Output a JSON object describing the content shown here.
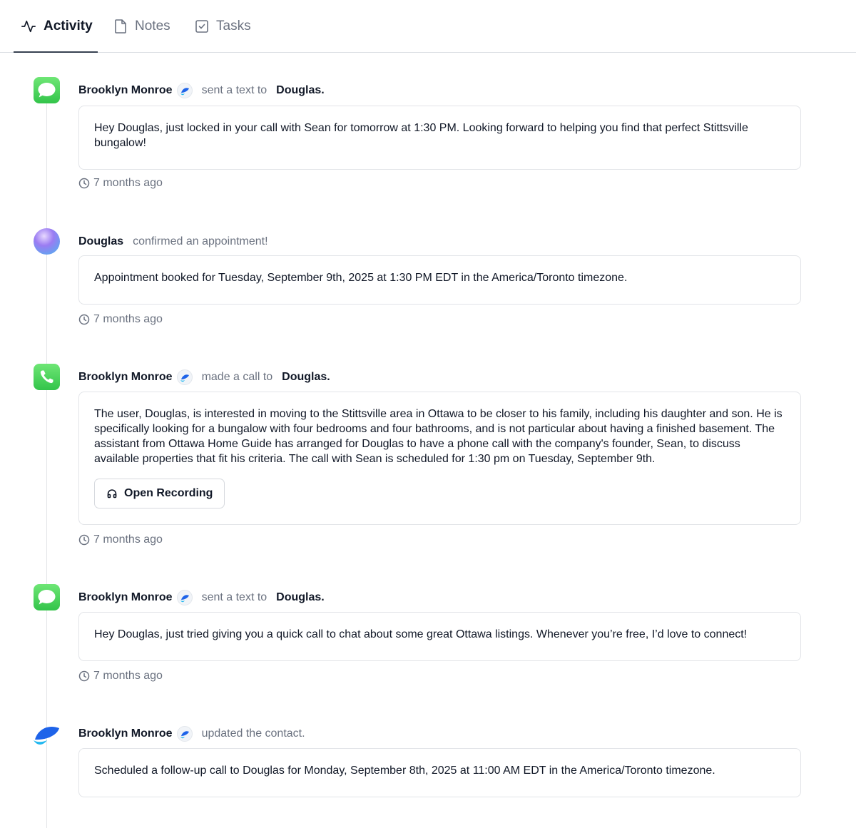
{
  "tabs": [
    {
      "label": "Activity",
      "icon": "activity-icon",
      "active": true
    },
    {
      "label": "Notes",
      "icon": "file-icon",
      "active": false
    },
    {
      "label": "Tasks",
      "icon": "checkbox-icon",
      "active": false
    }
  ],
  "colors": {
    "imessage_green": "#4cd964",
    "brand_blue": "#1e63e9",
    "text_primary": "#111827",
    "text_muted": "#6b7280",
    "border": "#e2e4e8"
  },
  "entries": [
    {
      "icon": "message-icon",
      "actor": "Brooklyn Monroe",
      "verb": "sent a text to",
      "target": "Douglas.",
      "body": "Hey Douglas, just locked in your call with Sean for tomorrow at 1:30 PM. Looking forward to helping you find that perfect Stittsville bungalow!",
      "time": "7 months ago"
    },
    {
      "icon": "contact-avatar-icon",
      "actor": "Douglas",
      "verb": "confirmed an appointment!",
      "body": "Appointment booked for Tuesday, September 9th, 2025 at 1:30 PM EDT in the America/Toronto timezone.",
      "time": "7 months ago"
    },
    {
      "icon": "phone-icon",
      "actor": "Brooklyn Monroe",
      "verb": "made a call to",
      "target": "Douglas.",
      "body": "The user, Douglas, is interested in moving to the Stittsville area in Ottawa to be closer to his family, including his daughter and son. He is specifically looking for a bungalow with four bedrooms and four bathrooms, and is not particular about having a finished basement. The assistant from Ottawa Home Guide has arranged for Douglas to have a phone call with the company's founder, Sean, to discuss available properties that fit his criteria. The call with Sean is scheduled for 1:30 pm on Tuesday, September 9th.",
      "button": "Open Recording",
      "time": "7 months ago"
    },
    {
      "icon": "message-icon",
      "actor": "Brooklyn Monroe",
      "verb": "sent a text to",
      "target": "Douglas.",
      "body": "Hey Douglas, just tried giving you a quick call to chat about some great Ottawa listings. Whenever you’re free, I’d love to connect!",
      "time": "7 months ago"
    },
    {
      "icon": "brand-logo-icon",
      "actor": "Brooklyn Monroe",
      "verb": "updated the contact.",
      "body": "Scheduled a follow-up call to Douglas for Monday, September 8th, 2025 at 11:00 AM EDT in the America/Toronto timezone."
    }
  ]
}
